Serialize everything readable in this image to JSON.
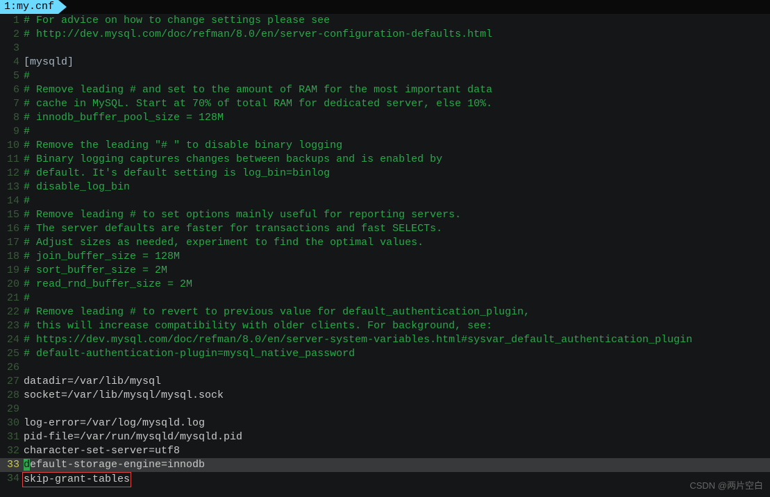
{
  "tab": {
    "index": "1:",
    "filename": "my.cnf"
  },
  "watermark": "CSDN @两片空白",
  "highlight_line": 33,
  "framed_line": 34,
  "lines": [
    {
      "n": 1,
      "cls": "cmt",
      "text": "# For advice on how to change settings please see"
    },
    {
      "n": 2,
      "cls": "cmt",
      "text": "# http://dev.mysql.com/doc/refman/8.0/en/server-configuration-defaults.html"
    },
    {
      "n": 3,
      "cls": "txt",
      "text": ""
    },
    {
      "n": 4,
      "cls": "sec",
      "text": "[mysqld]"
    },
    {
      "n": 5,
      "cls": "cmt",
      "text": "#"
    },
    {
      "n": 6,
      "cls": "cmt",
      "text": "# Remove leading # and set to the amount of RAM for the most important data"
    },
    {
      "n": 7,
      "cls": "cmt",
      "text": "# cache in MySQL. Start at 70% of total RAM for dedicated server, else 10%."
    },
    {
      "n": 8,
      "cls": "cmt",
      "text": "# innodb_buffer_pool_size = 128M"
    },
    {
      "n": 9,
      "cls": "cmt",
      "text": "#"
    },
    {
      "n": 10,
      "cls": "cmt",
      "text": "# Remove the leading \"# \" to disable binary logging"
    },
    {
      "n": 11,
      "cls": "cmt",
      "text": "# Binary logging captures changes between backups and is enabled by"
    },
    {
      "n": 12,
      "cls": "cmt",
      "text": "# default. It's default setting is log_bin=binlog"
    },
    {
      "n": 13,
      "cls": "cmt",
      "text": "# disable_log_bin"
    },
    {
      "n": 14,
      "cls": "cmt",
      "text": "#"
    },
    {
      "n": 15,
      "cls": "cmt",
      "text": "# Remove leading # to set options mainly useful for reporting servers."
    },
    {
      "n": 16,
      "cls": "cmt",
      "text": "# The server defaults are faster for transactions and fast SELECTs."
    },
    {
      "n": 17,
      "cls": "cmt",
      "text": "# Adjust sizes as needed, experiment to find the optimal values."
    },
    {
      "n": 18,
      "cls": "cmt",
      "text": "# join_buffer_size = 128M"
    },
    {
      "n": 19,
      "cls": "cmt",
      "text": "# sort_buffer_size = 2M"
    },
    {
      "n": 20,
      "cls": "cmt",
      "text": "# read_rnd_buffer_size = 2M"
    },
    {
      "n": 21,
      "cls": "cmt",
      "text": "#"
    },
    {
      "n": 22,
      "cls": "cmt",
      "text": "# Remove leading # to revert to previous value for default_authentication_plugin,"
    },
    {
      "n": 23,
      "cls": "cmt",
      "text": "# this will increase compatibility with older clients. For background, see:"
    },
    {
      "n": 24,
      "cls": "cmt",
      "text": "# https://dev.mysql.com/doc/refman/8.0/en/server-system-variables.html#sysvar_default_authentication_plugin"
    },
    {
      "n": 25,
      "cls": "cmt",
      "text": "# default-authentication-plugin=mysql_native_password"
    },
    {
      "n": 26,
      "cls": "txt",
      "text": ""
    },
    {
      "n": 27,
      "cls": "txt",
      "text": "datadir=/var/lib/mysql"
    },
    {
      "n": 28,
      "cls": "txt",
      "text": "socket=/var/lib/mysql/mysql.sock"
    },
    {
      "n": 29,
      "cls": "txt",
      "text": ""
    },
    {
      "n": 30,
      "cls": "txt",
      "text": "log-error=/var/log/mysqld.log"
    },
    {
      "n": 31,
      "cls": "txt",
      "text": "pid-file=/var/run/mysqld/mysqld.pid"
    },
    {
      "n": 32,
      "cls": "txt",
      "text": "character-set-server=utf8"
    },
    {
      "n": 33,
      "cls": "txt",
      "text": "default-storage-engine=innodb",
      "cursor_at": 0
    },
    {
      "n": 34,
      "cls": "txt",
      "text": "skip-grant-tables"
    }
  ]
}
